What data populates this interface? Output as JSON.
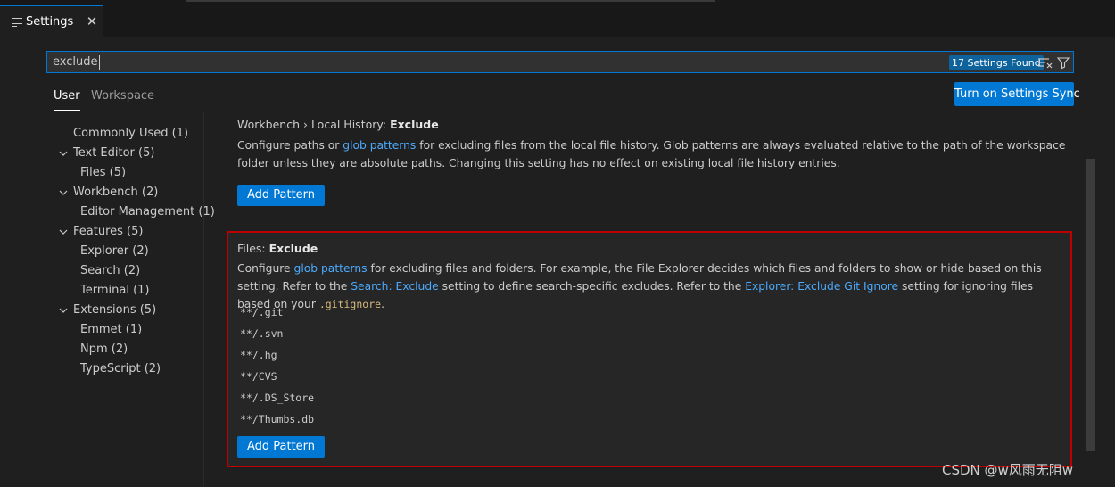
{
  "tab": {
    "title": "Settings",
    "close": "✕"
  },
  "search": {
    "value": "exclude",
    "count": "17 Settings Found"
  },
  "scopes": {
    "user": "User",
    "workspace": "Workspace"
  },
  "sync_button": "Turn on Settings Sync",
  "toc": [
    {
      "label": "Commonly Used (1)",
      "level": 0,
      "expandable": false
    },
    {
      "label": "Text Editor (5)",
      "level": 0,
      "expandable": true
    },
    {
      "label": "Files (5)",
      "level": 1,
      "expandable": false
    },
    {
      "label": "Workbench (2)",
      "level": 0,
      "expandable": true
    },
    {
      "label": "Editor Management (1)",
      "level": 1,
      "expandable": false
    },
    {
      "label": "Features (5)",
      "level": 0,
      "expandable": true
    },
    {
      "label": "Explorer (2)",
      "level": 1,
      "expandable": false
    },
    {
      "label": "Search (2)",
      "level": 1,
      "expandable": false
    },
    {
      "label": "Terminal (1)",
      "level": 1,
      "expandable": false
    },
    {
      "label": "Extensions (5)",
      "level": 0,
      "expandable": true
    },
    {
      "label": "Emmet (1)",
      "level": 1,
      "expandable": false
    },
    {
      "label": "Npm (2)",
      "level": 1,
      "expandable": false
    },
    {
      "label": "TypeScript (2)",
      "level": 1,
      "expandable": false
    }
  ],
  "setting1": {
    "category": "Workbench › Local History: ",
    "name": "Exclude",
    "desc_before": "Configure paths or ",
    "desc_link": "glob patterns",
    "desc_after": " for excluding files from the local file history. Glob patterns are always evaluated relative to the path of the workspace folder unless they are absolute paths. Changing this setting has no effect on existing local file history entries.",
    "button": "Add Pattern"
  },
  "setting2": {
    "category": "Files: ",
    "name": "Exclude",
    "desc_1": "Configure ",
    "link_1": "glob patterns",
    "desc_2": " for excluding files and folders. For example, the File Explorer decides which files and folders to show or hide based on this setting. Refer to the ",
    "link_2": "Search: Exclude",
    "desc_3": " setting to define search-specific excludes. Refer to the ",
    "link_3": "Explorer: Exclude Git Ignore",
    "desc_4": " setting for ignoring files based on your ",
    "code": ".gitignore",
    "desc_5": ".",
    "patterns": [
      "**/.git",
      "**/.svn",
      "**/.hg",
      "**/CVS",
      "**/.DS_Store",
      "**/Thumbs.db"
    ],
    "button": "Add Pattern"
  },
  "watermark": "CSDN @w风雨无阻w",
  "colors": {
    "accent": "#0078d4",
    "link": "#4daafc",
    "highlight_border": "#c00000"
  }
}
